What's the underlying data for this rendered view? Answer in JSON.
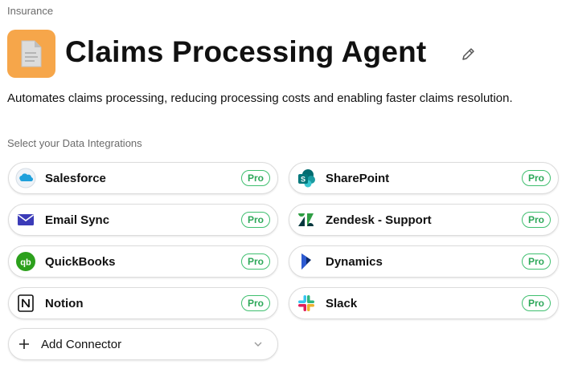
{
  "header": {
    "category": "Insurance",
    "title": "Claims Processing Agent",
    "description": "Automates claims processing, reducing processing costs and enabling faster claims resolution."
  },
  "integrations": {
    "section_label": "Select your Data Integrations",
    "badge_label": "Pro",
    "items": [
      {
        "name": "Salesforce",
        "icon": "salesforce-icon"
      },
      {
        "name": "SharePoint",
        "icon": "sharepoint-icon"
      },
      {
        "name": "Email Sync",
        "icon": "email-icon"
      },
      {
        "name": "Zendesk - Support",
        "icon": "zendesk-icon"
      },
      {
        "name": "QuickBooks",
        "icon": "quickbooks-icon"
      },
      {
        "name": "Dynamics",
        "icon": "dynamics-icon"
      },
      {
        "name": "Notion",
        "icon": "notion-icon"
      },
      {
        "name": "Slack",
        "icon": "slack-icon"
      }
    ],
    "add_connector_label": "Add Connector"
  },
  "colors": {
    "app_icon_bg": "#f6a64a",
    "pro_badge": "#3fbf6f",
    "salesforce": "#1ea0db",
    "sharepoint": "#036c70",
    "email": "#3b3bb8",
    "zendesk": "#03363d",
    "quickbooks": "#2ca01c",
    "dynamics": "#0b2a6e"
  }
}
